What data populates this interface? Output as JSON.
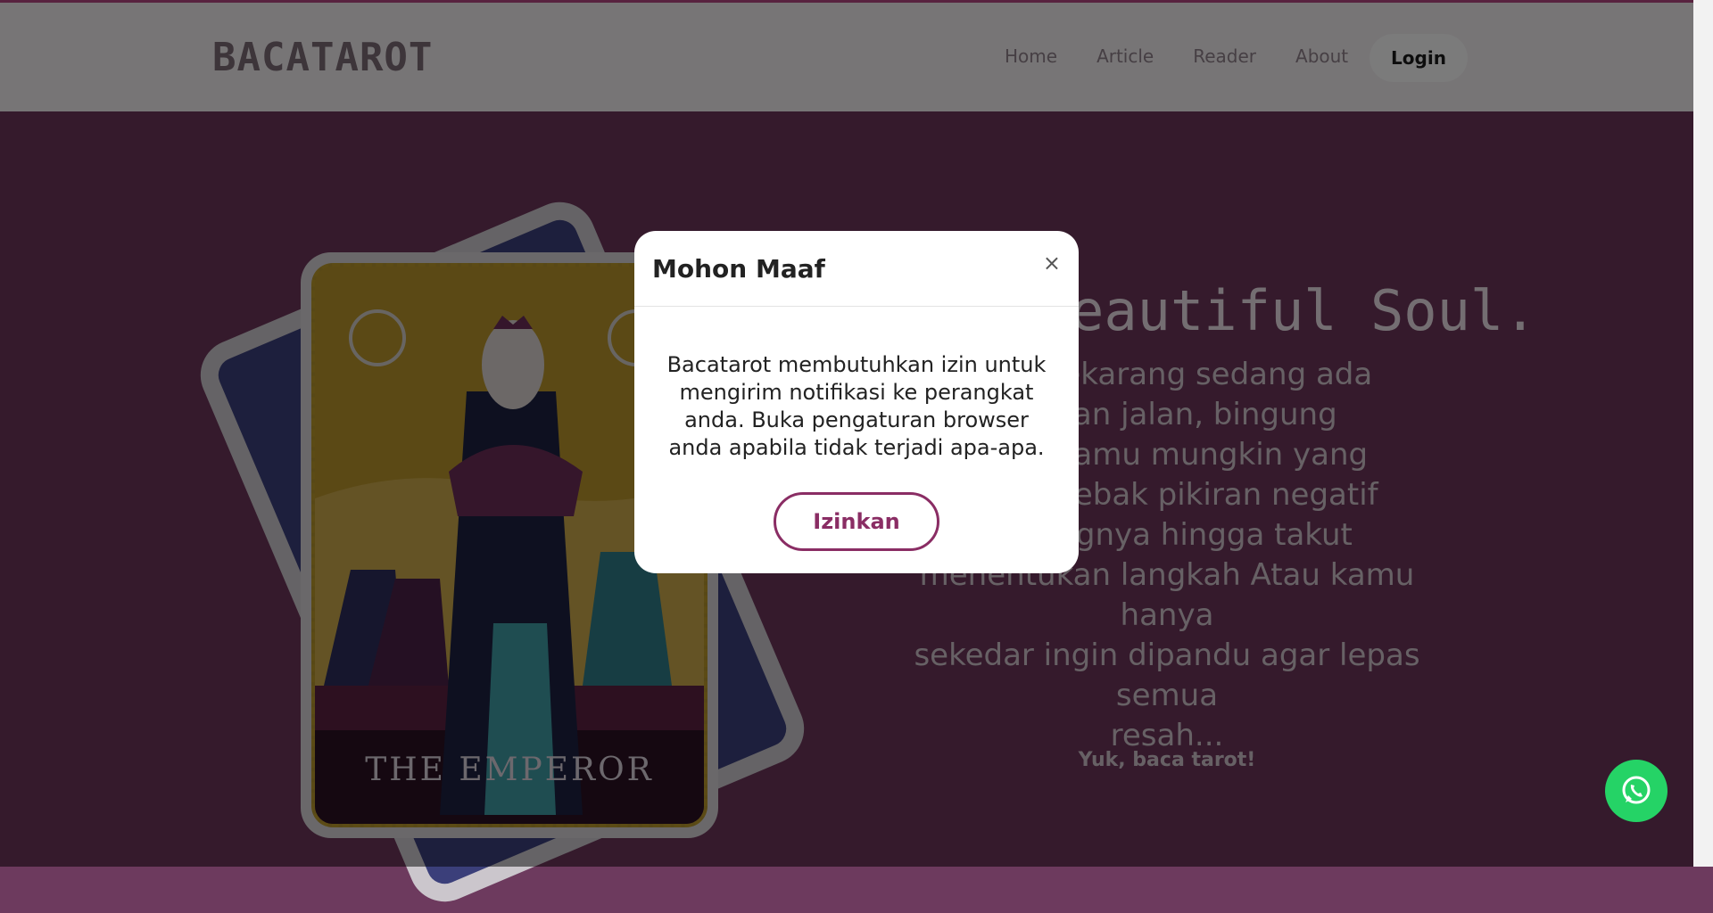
{
  "header": {
    "logo": "BACATAROT",
    "nav": [
      {
        "label": "Home"
      },
      {
        "label": "Article"
      },
      {
        "label": "Reader"
      },
      {
        "label": "About"
      }
    ],
    "login_label": "Login"
  },
  "hero": {
    "card_title": "THE EMPEROR",
    "title": "eautiful Soul.",
    "lines": [
      "yang sekarang sedang ada",
      "pangan jalan, bingung",
      "arah. Kamu mungkin yang",
      "ang terjebak pikiran negatif",
      "a ujungnya hingga takut",
      "menentukan langkah Atau kamu hanya",
      "sekedar ingin dipandu agar lepas semua",
      "resah..."
    ],
    "cta": "Yuk, baca tarot!"
  },
  "modal": {
    "title": "Mohon Maaf",
    "close_symbol": "×",
    "message": "Bacatarot membutuhkan izin untuk mengirim notifikasi ke perangkat anda. Buka pengaturan browser anda apabila tidak terjadi apa-apa.",
    "button_label": "Izinkan"
  },
  "colors": {
    "brand": "#8a2d64",
    "whatsapp": "#25d366"
  },
  "icons": {
    "floating": "whatsapp-icon"
  }
}
